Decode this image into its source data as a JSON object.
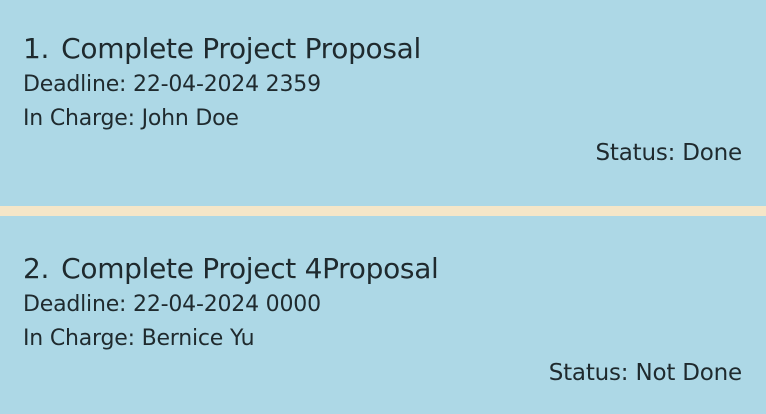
{
  "tasks": [
    {
      "index": "1.",
      "title": "Complete Project Proposal",
      "deadline": "Deadline: 22-04-2024 2359",
      "in_charge": "In Charge: John Doe",
      "status": "Status: Done"
    },
    {
      "index": "2.",
      "title": "Complete Project 4Proposal",
      "deadline": "Deadline: 22-04-2024 0000",
      "in_charge": "In Charge: Bernice Yu",
      "status": "Status: Not Done"
    }
  ],
  "colors": {
    "card_background": "#add8e6",
    "separator": "#f5e6c8",
    "text": "#1f2a2e"
  }
}
